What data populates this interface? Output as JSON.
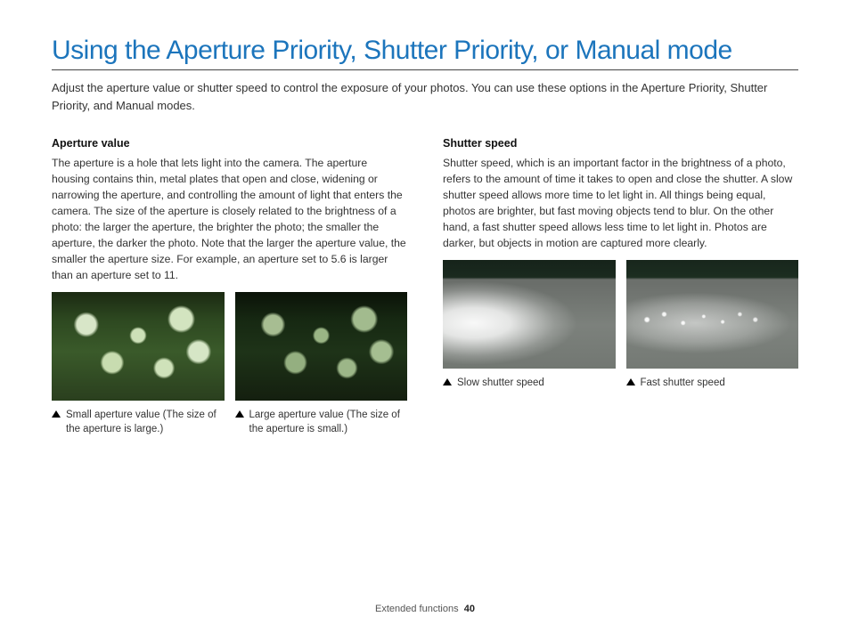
{
  "title": "Using the Aperture Priority, Shutter Priority, or Manual mode",
  "intro": "Adjust the aperture value or shutter speed to control the exposure of your photos. You can use these options in the Aperture Priority, Shutter Priority, and Manual modes.",
  "left": {
    "heading": "Aperture value",
    "body": "The aperture is a hole that lets light into the camera. The aperture housing contains thin, metal plates that open and close, widening or narrowing the aperture, and controlling the amount of light that enters the camera. The size of the aperture is closely related to the brightness of a photo: the larger the aperture, the brighter the photo; the smaller the aperture, the darker the photo. Note that the larger the aperture value, the smaller the aperture size. For example, an aperture set to 5.6 is larger than an aperture set to 11.",
    "caption1": "Small aperture value (The size of the aperture is large.)",
    "caption2": "Large aperture value (The size of the aperture is small.)"
  },
  "right": {
    "heading": "Shutter speed",
    "body": "Shutter speed, which is an important factor in the brightness of a photo, refers to the amount of time it takes to open and close the shutter. A slow shutter speed allows more time to let light in. All things being equal, photos are brighter, but fast moving objects tend to blur. On the other hand, a fast shutter speed allows less time to let light in. Photos are darker, but objects in motion are captured more clearly.",
    "caption1": "Slow shutter speed",
    "caption2": "Fast shutter speed"
  },
  "footer": {
    "section": "Extended functions",
    "page": "40"
  }
}
